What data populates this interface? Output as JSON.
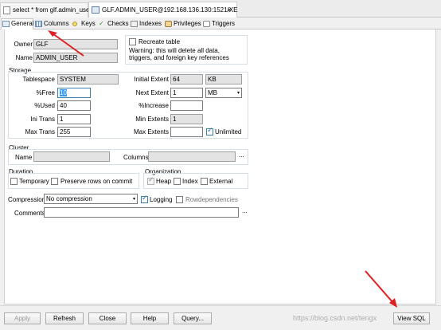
{
  "doc_tabs": [
    {
      "label": "select * from glf.admin_user"
    },
    {
      "label": "GLF.ADMIN_USER@192.168.136.130:1521/XE"
    }
  ],
  "close_glyph": "✕",
  "tabs": [
    "General",
    "Columns",
    "Keys",
    "Checks",
    "Indexes",
    "Privileges",
    "Triggers"
  ],
  "owner": {
    "label": "Owner",
    "value": "GLF"
  },
  "name": {
    "label": "Name",
    "value": "ADMIN_USER"
  },
  "recreate": {
    "label": "Recreate table",
    "warning": "Warning: this will delete all data, triggers, and foreign key references"
  },
  "storage": {
    "title": "Storage",
    "tablespace_label": "Tablespace",
    "tablespace": "SYSTEM",
    "pctfree_label": "%Free",
    "pctfree": "10",
    "pctused_label": "%Used",
    "pctused": "40",
    "initrans_label": "Ini Trans",
    "initrans": "1",
    "maxtrans_label": "Max Trans",
    "maxtrans": "255",
    "initial_extent_label": "Initial Extent",
    "initial_extent": "64",
    "initial_extent_unit": "KB",
    "next_extent_label": "Next Extent",
    "next_extent": "1",
    "next_extent_unit": "MB",
    "pctincrease_label": "%Increase",
    "pctincrease": "",
    "min_extents_label": "Min Extents",
    "min_extents": "1",
    "max_extents_label": "Max Extents",
    "max_extents": "",
    "unlimited_label": "Unlimited"
  },
  "cluster": {
    "title": "Cluster",
    "name_label": "Name",
    "columns_label": "Columns",
    "ellipsis": "..."
  },
  "duration": {
    "title": "Duration",
    "temporary": "Temporary",
    "preserve": "Preserve rows on commit"
  },
  "organization": {
    "title": "Organization",
    "heap": "Heap",
    "index": "Index",
    "external": "External"
  },
  "compression": {
    "label": "Compression",
    "value": "No compression"
  },
  "logging_label": "Logging",
  "rowdependencies_label": "Rowdependencies",
  "comments": {
    "label": "Comments",
    "value": "",
    "ellipsis": "..."
  },
  "buttons": {
    "apply": "Apply",
    "refresh": "Refresh",
    "close": "Close",
    "help": "Help",
    "query": "Query...",
    "view_sql": "View SQL"
  },
  "watermark": "https://blog.csdn.net/tengx",
  "colors": {
    "arrow": "#e02020",
    "selection": "#3399ff"
  }
}
